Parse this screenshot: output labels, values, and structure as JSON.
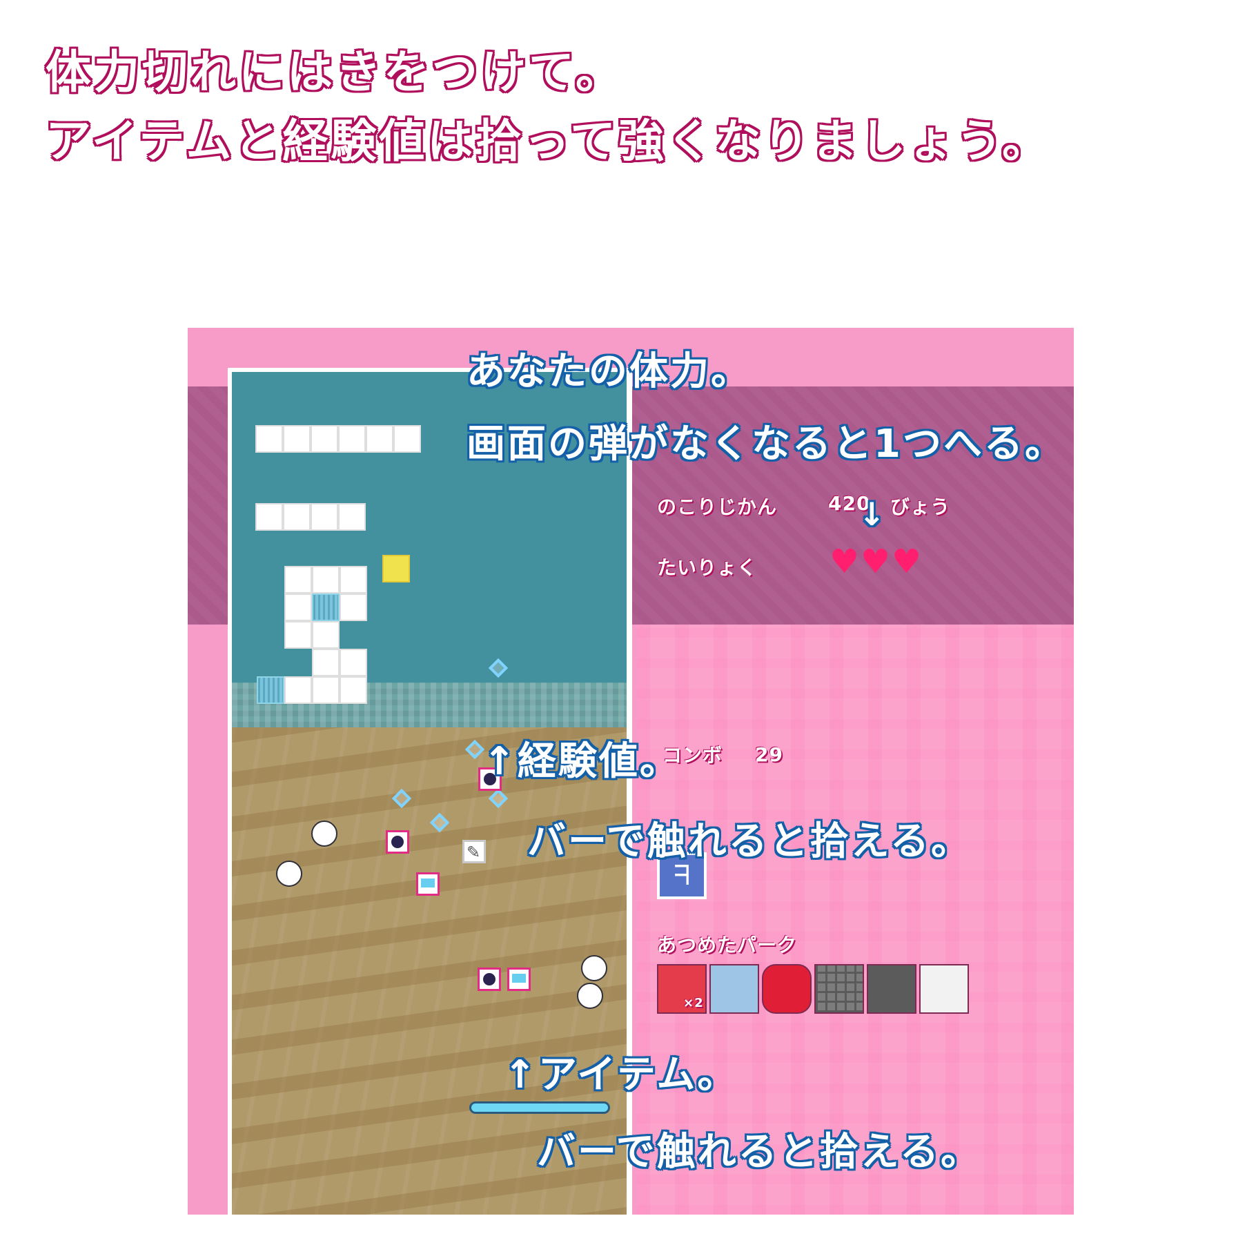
{
  "headings": {
    "line1": "体力切れにはきをつけて。",
    "line2": "アイテムと経験値は拾って強くなりましょう。"
  },
  "hud": {
    "time_label": "のこりじかん",
    "time_value": "420",
    "time_unit": "びょう",
    "hp_label": "たいりょく",
    "hp_value": 3,
    "combo_label": "コンボ",
    "combo_value": "29",
    "perks_label": "あつめたパーク",
    "perk_multiplier": "×2"
  },
  "callouts": {
    "hp_line1": "あなたの体力。",
    "hp_line2": "画面の弾がなくなると1つへる。",
    "hp_arrow": "↓",
    "exp_line1": "↑経験値。",
    "exp_line2": "バーで触れると拾える。",
    "item_line1": "↑アイテム。",
    "item_line2": "バーで触れると拾える。"
  },
  "icons": {
    "heart": "heart-icon",
    "exp": "diamond-exp-icon",
    "item_bomb": "bomb-item-icon",
    "item_screen": "screen-item-icon",
    "item_gear": "gear-item-icon",
    "skill": "wing-skill-icon",
    "perks": [
      "red-tag-icon",
      "leaf-icon",
      "red-ring-icon",
      "grey-grid-icon",
      "dumbbell-icon",
      "calculator-icon"
    ]
  },
  "colors": {
    "heading_outline": "#b00f5c",
    "callout_outline": "#1460a8",
    "heart": "#ff1f6e"
  }
}
